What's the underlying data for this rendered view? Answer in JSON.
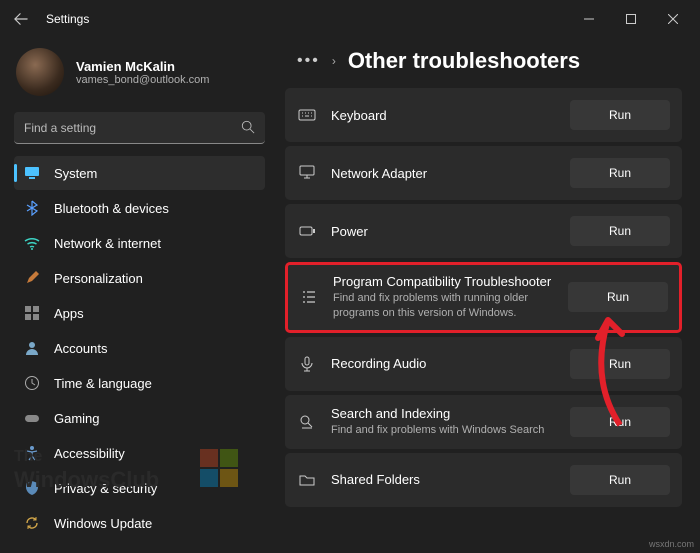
{
  "titlebar": {
    "title": "Settings"
  },
  "user": {
    "name": "Vamien McKalin",
    "email": "vames_bond@outlook.com"
  },
  "search": {
    "placeholder": "Find a setting"
  },
  "nav": {
    "system": "System",
    "bluetooth": "Bluetooth & devices",
    "network": "Network & internet",
    "personalization": "Personalization",
    "apps": "Apps",
    "accounts": "Accounts",
    "time": "Time & language",
    "gaming": "Gaming",
    "accessibility": "Accessibility",
    "privacy": "Privacy & security",
    "update": "Windows Update"
  },
  "header": {
    "title": "Other troubleshooters"
  },
  "items": {
    "keyboard": {
      "title": "Keyboard",
      "run": "Run"
    },
    "network": {
      "title": "Network Adapter",
      "run": "Run"
    },
    "power": {
      "title": "Power",
      "run": "Run"
    },
    "program": {
      "title": "Program Compatibility Troubleshooter",
      "sub": "Find and fix problems with running older programs on this version of Windows.",
      "run": "Run"
    },
    "recording": {
      "title": "Recording Audio",
      "run": "Run"
    },
    "search": {
      "title": "Search and Indexing",
      "sub": "Find and fix problems with Windows Search",
      "run": "Run"
    },
    "shared": {
      "title": "Shared Folders",
      "run": "Run"
    }
  },
  "watermark": {
    "line1": "The",
    "line2": "WindowsClub"
  },
  "url": "wsxdn.com"
}
